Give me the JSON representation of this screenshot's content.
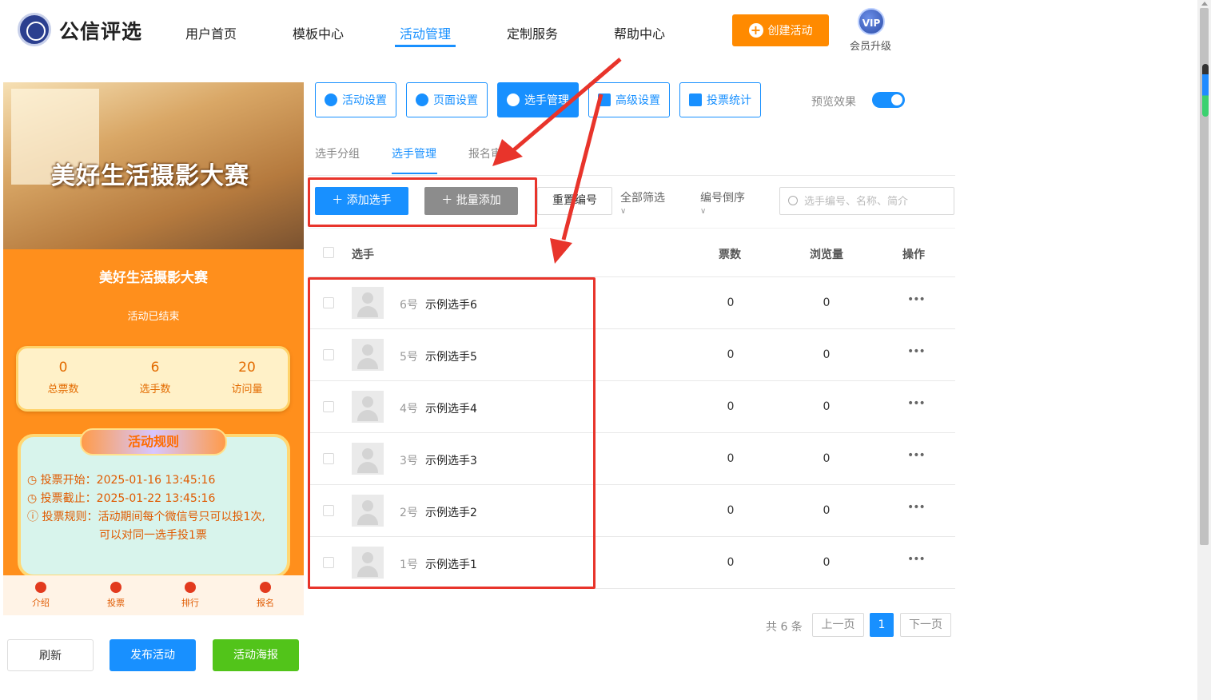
{
  "header": {
    "logo_text": "公信评选",
    "nav": [
      "用户首页",
      "模板中心",
      "活动管理",
      "定制服务",
      "帮助中心"
    ],
    "create_button": "创建活动",
    "vip_badge": "VIP",
    "vip_label": "会员升级"
  },
  "phone": {
    "banner_title": "美好生活摄影大赛",
    "title": "美好生活摄影大赛",
    "status": "活动已结束",
    "stats": [
      {
        "value": "0",
        "label": "总票数"
      },
      {
        "value": "6",
        "label": "选手数"
      },
      {
        "value": "20",
        "label": "访问量"
      }
    ],
    "rules_title": "活动规则",
    "rules": [
      "投票开始：2025-01-16 13:45:16",
      "投票截止：2025-01-22 13:45:16",
      "投票规则：活动期间每个微信号只可以投1次,",
      "可以对同一选手投1票"
    ],
    "tabs": [
      "介绍",
      "投票",
      "排行",
      "报名"
    ]
  },
  "bottom_buttons": {
    "refresh": "刷新",
    "publish": "发布活动",
    "poster": "活动海报"
  },
  "toolbar": {
    "buttons": [
      "活动设置",
      "页面设置",
      "选手管理",
      "高级设置",
      "投票统计"
    ],
    "preview_label": "预览效果"
  },
  "subtabs": [
    "选手分组",
    "选手管理",
    "报名审"
  ],
  "actions": {
    "add": "添加选手",
    "batch_add": "批量添加",
    "renumber": "重置编号",
    "filter_all": "全部筛选",
    "sort": "编号倒序",
    "search_placeholder": "选手编号、名称、简介"
  },
  "table": {
    "headers": {
      "player": "选手",
      "votes": "票数",
      "views": "浏览量",
      "ops": "操作"
    },
    "rows": [
      {
        "num": "6号",
        "name": "示例选手6",
        "votes": "0",
        "views": "0"
      },
      {
        "num": "5号",
        "name": "示例选手5",
        "votes": "0",
        "views": "0"
      },
      {
        "num": "4号",
        "name": "示例选手4",
        "votes": "0",
        "views": "0"
      },
      {
        "num": "3号",
        "name": "示例选手3",
        "votes": "0",
        "views": "0"
      },
      {
        "num": "2号",
        "name": "示例选手2",
        "votes": "0",
        "views": "0"
      },
      {
        "num": "1号",
        "name": "示例选手1",
        "votes": "0",
        "views": "0"
      }
    ],
    "more": "•••"
  },
  "pagination": {
    "total": "共 6 条",
    "prev": "上一页",
    "current": "1",
    "next": "下一页"
  },
  "colors": {
    "primary": "#1890ff",
    "orange": "#ff8a00",
    "green": "#52c41a",
    "annotation": "#e8342b"
  }
}
